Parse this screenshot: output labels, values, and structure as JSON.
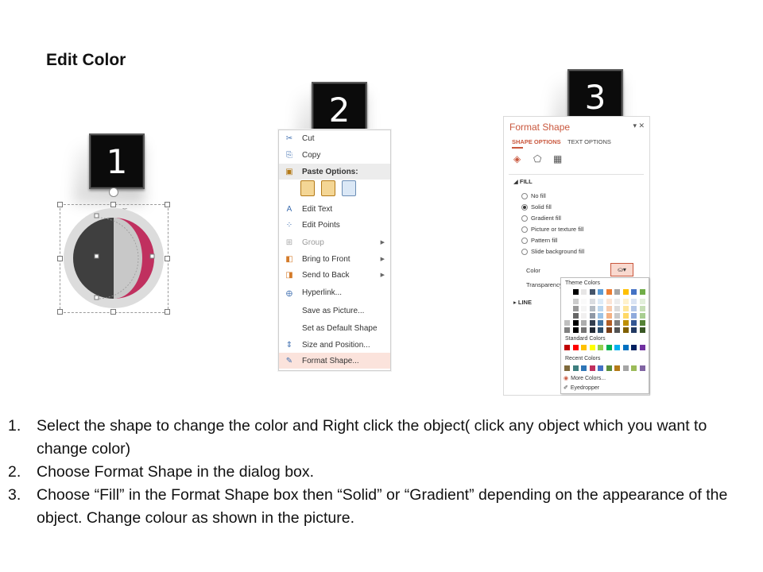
{
  "title": "Edit Color",
  "badges": [
    "1",
    "2",
    "3"
  ],
  "context_menu": {
    "items": [
      {
        "label": "Cut",
        "icon": "scissors-icon"
      },
      {
        "label": "Copy",
        "icon": "copy-icon"
      },
      {
        "label": "Paste Options:",
        "icon": "paste-icon"
      },
      {
        "label": "Edit Text",
        "icon": "edit-text-icon"
      },
      {
        "label": "Edit Points",
        "icon": "edit-points-icon"
      },
      {
        "label": "Group",
        "icon": "group-icon"
      },
      {
        "label": "Bring to Front",
        "icon": "bring-front-icon"
      },
      {
        "label": "Send to Back",
        "icon": "send-back-icon"
      },
      {
        "label": "Hyperlink...",
        "icon": "hyperlink-icon"
      },
      {
        "label": "Save as Picture...",
        "icon": ""
      },
      {
        "label": "Set as Default Shape",
        "icon": ""
      },
      {
        "label": "Size and Position...",
        "icon": "size-position-icon"
      },
      {
        "label": "Format Shape...",
        "icon": "format-shape-icon"
      }
    ]
  },
  "format_pane": {
    "title": "Format Shape",
    "tabs": [
      "SHAPE OPTIONS",
      "TEXT OPTIONS"
    ],
    "fill_header": "FILL",
    "fill_options": [
      "No fill",
      "Solid fill",
      "Gradient fill",
      "Picture or texture fill",
      "Pattern fill",
      "Slide background fill"
    ],
    "color_label": "Color",
    "transparency_label": "Transparency",
    "line_header": "LINE",
    "palette": {
      "theme_label": "Theme Colors",
      "standard_label": "Standard Colors",
      "recent_label": "Recent Colors",
      "more_colors": "More Colors...",
      "eyedropper": "Eyedropper"
    }
  },
  "colors": {
    "accent": "#c9573d",
    "moon_pink": "#c0305f",
    "moon_dark": "#3f3f3f"
  },
  "steps": [
    {
      "num": "1.",
      "text": "Select the shape to change the color and Right click the object( click any object which you want to change color)"
    },
    {
      "num": "2.",
      "text": "Choose Format Shape in the dialog box."
    },
    {
      "num": "3.",
      "text": "Choose “Fill” in the Format Shape box then “Solid” or “Gradient” depending on the appearance of the object. Change colour as shown in the picture."
    }
  ]
}
